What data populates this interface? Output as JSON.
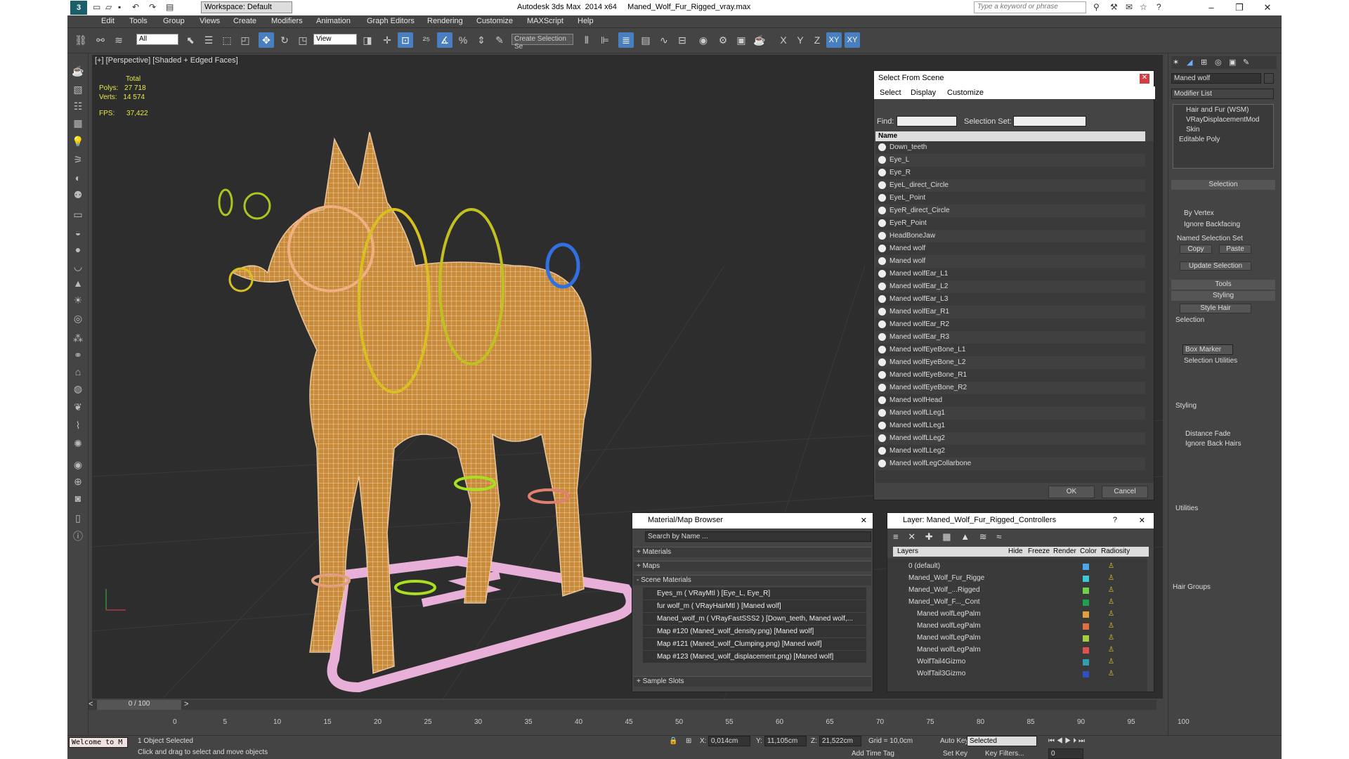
{
  "titlebar": {
    "app": "Autodesk 3ds Max  2014 x64",
    "file": "Maned_Wolf_Fur_Rigged_vray.max",
    "workspace": "Workspace: Default",
    "search_placeholder": "Type a keyword or phrase"
  },
  "menu": [
    "Edit",
    "Tools",
    "Group",
    "Views",
    "Create",
    "Modifiers",
    "Animation",
    "Graph Editors",
    "Rendering",
    "Customize",
    "MAXScript",
    "Help"
  ],
  "toolbar": {
    "filter": "All",
    "ref_coord": "View",
    "named_sel": "Create Selection Se",
    "axes": [
      "X",
      "Y",
      "Z",
      "XY",
      "XY"
    ]
  },
  "viewport": {
    "label": "[+] [Perspective] [Shaded + Edged Faces]",
    "stats": {
      "total": "Total",
      "polys_label": "Polys:",
      "polys": "27 718",
      "verts_label": "Verts:",
      "verts": "14 574",
      "fps_label": "FPS:",
      "fps": "37,422"
    }
  },
  "select_from_scene": {
    "title": "Select From Scene",
    "menu": [
      "Select",
      "Display",
      "Customize"
    ],
    "find_label": "Find:",
    "selset_label": "Selection Set:",
    "col_name": "Name",
    "ok": "OK",
    "cancel": "Cancel",
    "items": [
      "Down_teeth",
      "Eye_L",
      "Eye_R",
      "EyeL_direct_Circle",
      "EyeL_Point",
      "EyeR_direct_Circle",
      "EyeR_Point",
      "HeadBoneJaw",
      "Maned wolf",
      "Maned wolf",
      "Maned wolfEar_L1",
      "Maned wolfEar_L2",
      "Maned wolfEar_L3",
      "Maned wolfEar_R1",
      "Maned wolfEar_R2",
      "Maned wolfEar_R3",
      "Maned wolfEyeBone_L1",
      "Maned wolfEyeBone_L2",
      "Maned wolfEyeBone_R1",
      "Maned wolfEyeBone_R2",
      "Maned wolfHead",
      "Maned wolfLLeg1",
      "Maned wolfLLeg1",
      "Maned wolfLLeg2",
      "Maned wolfLLeg2",
      "Maned wolfLegCollarbone"
    ]
  },
  "material_browser": {
    "title": "Material/Map Browser",
    "search": "Search by Name ...",
    "sections": [
      "+ Materials",
      "+ Maps",
      "- Scene Materials",
      "+ Sample Slots"
    ],
    "items": [
      "Eyes_m  ( VRayMtl )  [Eye_L, Eye_R]",
      "fur wolf_m  ( VRayHairMtl )  [Maned wolf]",
      "Maned_wolf_m  ( VRayFastSSS2 )  [Down_teeth, Maned wolf,...",
      "Map #120 (Maned_wolf_density.png) [Maned wolf]",
      "Map #121 (Maned_wolf_Clumping.png)  [Maned wolf]",
      "Map #123 (Maned_wolf_displacement.png) [Maned wolf]"
    ]
  },
  "layer_explorer": {
    "title": "Layer: Maned_Wolf_Fur_Rigged_Controllers",
    "help": "?",
    "cols": [
      "Layers",
      "Hide",
      "Freeze",
      "Render",
      "Color",
      "Radiosity"
    ],
    "rows": [
      "0 (default)",
      "Maned_Wolf_Fur_Rigge",
      "Maned_Wolf_...Rigged",
      "Maned_Wolf_F..._Cont",
      "Maned wolfLegPalm",
      "Maned wolfLegPalm",
      "Maned wolfLegPalm",
      "Maned wolfLegPalm",
      "WolfTail4Gizmo",
      "WolfTail3Gizmo"
    ],
    "colors": [
      "#4aa8e8",
      "#3fc6d8",
      "#6fd04a",
      "#1fa050",
      "#e0a040",
      "#e07040",
      "#a0d040",
      "#e05050",
      "#30a0b0",
      "#3050c0"
    ]
  },
  "command_panel": {
    "object_name": "Maned wolf",
    "modifier_list": "Modifier List",
    "stack": [
      "Hair and Fur (WSM)",
      "VRayDisplacementMod",
      "Skin",
      "Editable Poly"
    ],
    "selection": "Selection",
    "by_vertex": "By Vertex",
    "ignore_backfacing": "Ignore Backfacing",
    "named_sel_set": "Named Selection Set",
    "copy": "Copy",
    "paste": "Paste",
    "update_selection": "Update Selection",
    "tools": "Tools",
    "styling": "Styling",
    "style_hair": "Style Hair",
    "sel2": "Selection",
    "box_marker": "Box Marker",
    "sel_utilities": "Selection Utilities",
    "styling2": "Styling",
    "distance_fade": "Distance Fade",
    "ignore_back_hairs": "Ignore Back Hairs",
    "utilities": "Utilities",
    "hair_groups": "Hair Groups"
  },
  "timeline": {
    "frame": "0 / 100",
    "ticks": [
      "0",
      "5",
      "10",
      "15",
      "20",
      "25",
      "30",
      "35",
      "40",
      "45",
      "50",
      "55",
      "60",
      "65",
      "70",
      "75",
      "80",
      "85",
      "90",
      "95",
      "100"
    ]
  },
  "status": {
    "selected": "1 Object Selected",
    "prompt": "Click and drag to select and move objects",
    "listener": "Welcome to M",
    "x": "0,014cm",
    "y": "11,105cm",
    "z": "21,522cm",
    "grid": "Grid = 10,0cm",
    "add_time_tag": "Add Time Tag",
    "auto_key": "Auto Key",
    "set_key": "Set Key",
    "selected_dd": "Selected",
    "key_filters": "Key Filters...",
    "frame_field": "0"
  }
}
